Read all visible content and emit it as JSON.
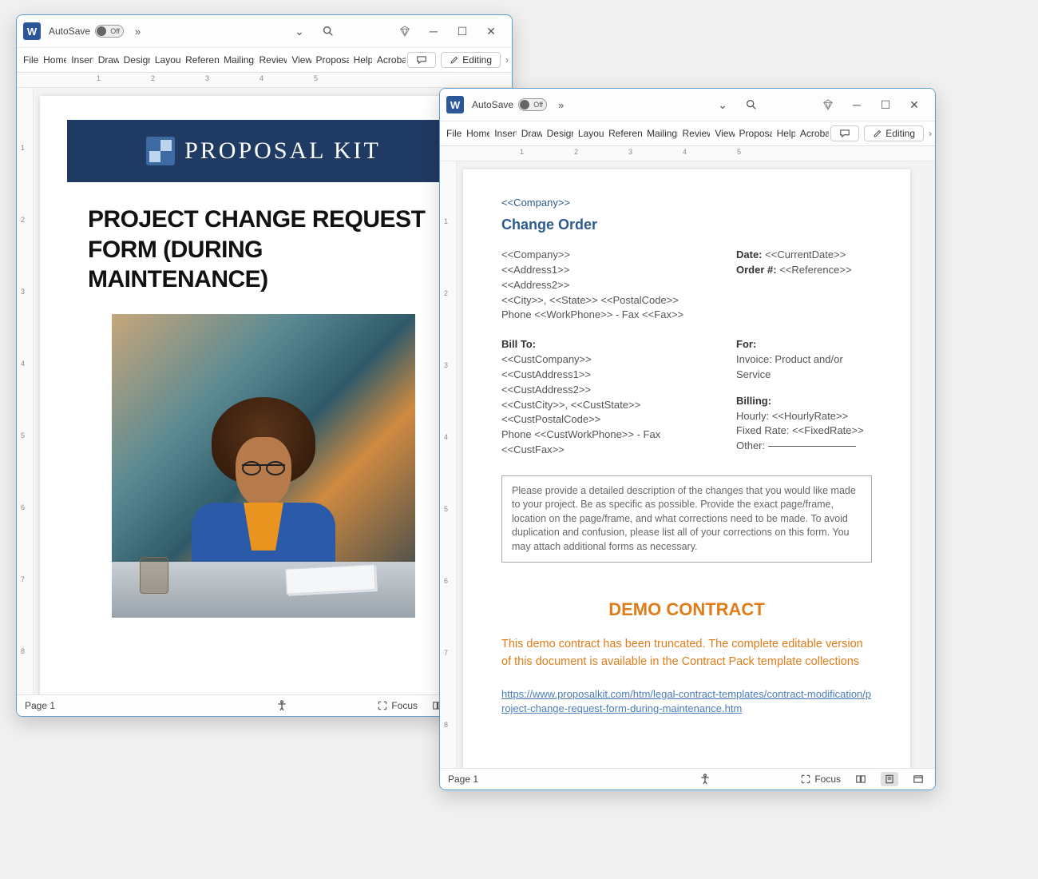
{
  "autosave_label": "AutoSave",
  "autosave_state": "Off",
  "ribbon_tabs": [
    "File",
    "Home",
    "Insert",
    "Draw",
    "Design",
    "Layout",
    "References",
    "Mailings",
    "Review",
    "View",
    "Proposal",
    "Help",
    "Acrobat"
  ],
  "editing_label": "Editing",
  "page_label": "Page 1",
  "focus_label": "Focus",
  "ruler_numbers": [
    "1",
    "2",
    "3",
    "4",
    "5"
  ],
  "vruler_numbers": [
    "1",
    "2",
    "3",
    "4",
    "5",
    "6",
    "7",
    "8"
  ],
  "doc1": {
    "banner_text": "PROPOSAL KIT",
    "title": "PROJECT CHANGE REQUEST FORM (DURING MAINTENANCE)"
  },
  "doc2": {
    "company_ph": "<<Company>>",
    "change_order": "Change Order",
    "left_block1": [
      "<<Company>>",
      "<<Address1>>",
      "<<Address2>>",
      "<<City>>, <<State>>  <<PostalCode>>",
      "Phone <<WorkPhone>>  - Fax <<Fax>>"
    ],
    "date_label": "Date:",
    "date_val": "<<CurrentDate>>",
    "order_label": "Order #:",
    "order_val": "<<Reference>>",
    "billto_label": "Bill To:",
    "left_block2": [
      "<<CustCompany>>",
      "<<CustAddress1>>",
      "<<CustAddress2>>",
      "<<CustCity>>, <<CustState>>",
      "<<CustPostalCode>>",
      "Phone <<CustWorkPhone>>  - Fax",
      "<<CustFax>>"
    ],
    "for_label": "For:",
    "for_val": "Invoice: Product and/or Service",
    "billing_label": "Billing:",
    "hourly": "Hourly: <<HourlyRate>>",
    "fixed": "Fixed Rate: <<FixedRate>>",
    "other": "Other:",
    "box_text": "Please provide a detailed description of the changes that you would like made to your project.  Be as specific as possible.  Provide the exact page/frame, location on the page/frame, and what corrections need to be made.  To avoid duplication and confusion, please list all of your corrections on this form.  You may attach additional forms as necessary.",
    "demo_title": "DEMO CONTRACT",
    "demo_text": "This demo contract has been truncated. The complete editable version of this document is available in the Contract Pack template collections",
    "demo_link": "https://www.proposalkit.com/htm/legal-contract-templates/contract-modification/project-change-request-form-during-maintenance.htm"
  }
}
